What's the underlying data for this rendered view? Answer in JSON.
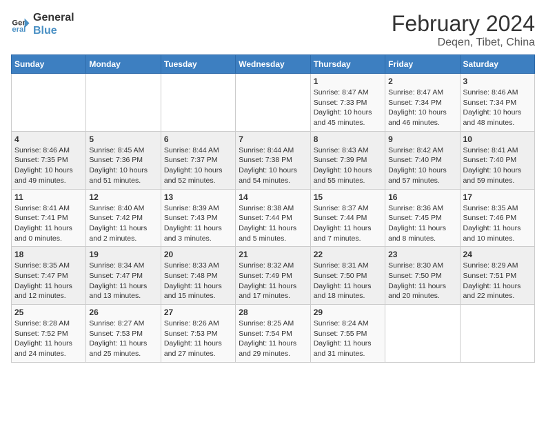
{
  "logo": {
    "text_general": "General",
    "text_blue": "Blue"
  },
  "title": "February 2024",
  "subtitle": "Deqen, Tibet, China",
  "weekdays": [
    "Sunday",
    "Monday",
    "Tuesday",
    "Wednesday",
    "Thursday",
    "Friday",
    "Saturday"
  ],
  "weeks": [
    [
      {
        "day": "",
        "info": ""
      },
      {
        "day": "",
        "info": ""
      },
      {
        "day": "",
        "info": ""
      },
      {
        "day": "",
        "info": ""
      },
      {
        "day": "1",
        "info": "Sunrise: 8:47 AM\nSunset: 7:33 PM\nDaylight: 10 hours\nand 45 minutes."
      },
      {
        "day": "2",
        "info": "Sunrise: 8:47 AM\nSunset: 7:34 PM\nDaylight: 10 hours\nand 46 minutes."
      },
      {
        "day": "3",
        "info": "Sunrise: 8:46 AM\nSunset: 7:34 PM\nDaylight: 10 hours\nand 48 minutes."
      }
    ],
    [
      {
        "day": "4",
        "info": "Sunrise: 8:46 AM\nSunset: 7:35 PM\nDaylight: 10 hours\nand 49 minutes."
      },
      {
        "day": "5",
        "info": "Sunrise: 8:45 AM\nSunset: 7:36 PM\nDaylight: 10 hours\nand 51 minutes."
      },
      {
        "day": "6",
        "info": "Sunrise: 8:44 AM\nSunset: 7:37 PM\nDaylight: 10 hours\nand 52 minutes."
      },
      {
        "day": "7",
        "info": "Sunrise: 8:44 AM\nSunset: 7:38 PM\nDaylight: 10 hours\nand 54 minutes."
      },
      {
        "day": "8",
        "info": "Sunrise: 8:43 AM\nSunset: 7:39 PM\nDaylight: 10 hours\nand 55 minutes."
      },
      {
        "day": "9",
        "info": "Sunrise: 8:42 AM\nSunset: 7:40 PM\nDaylight: 10 hours\nand 57 minutes."
      },
      {
        "day": "10",
        "info": "Sunrise: 8:41 AM\nSunset: 7:40 PM\nDaylight: 10 hours\nand 59 minutes."
      }
    ],
    [
      {
        "day": "11",
        "info": "Sunrise: 8:41 AM\nSunset: 7:41 PM\nDaylight: 11 hours\nand 0 minutes."
      },
      {
        "day": "12",
        "info": "Sunrise: 8:40 AM\nSunset: 7:42 PM\nDaylight: 11 hours\nand 2 minutes."
      },
      {
        "day": "13",
        "info": "Sunrise: 8:39 AM\nSunset: 7:43 PM\nDaylight: 11 hours\nand 3 minutes."
      },
      {
        "day": "14",
        "info": "Sunrise: 8:38 AM\nSunset: 7:44 PM\nDaylight: 11 hours\nand 5 minutes."
      },
      {
        "day": "15",
        "info": "Sunrise: 8:37 AM\nSunset: 7:44 PM\nDaylight: 11 hours\nand 7 minutes."
      },
      {
        "day": "16",
        "info": "Sunrise: 8:36 AM\nSunset: 7:45 PM\nDaylight: 11 hours\nand 8 minutes."
      },
      {
        "day": "17",
        "info": "Sunrise: 8:35 AM\nSunset: 7:46 PM\nDaylight: 11 hours\nand 10 minutes."
      }
    ],
    [
      {
        "day": "18",
        "info": "Sunrise: 8:35 AM\nSunset: 7:47 PM\nDaylight: 11 hours\nand 12 minutes."
      },
      {
        "day": "19",
        "info": "Sunrise: 8:34 AM\nSunset: 7:47 PM\nDaylight: 11 hours\nand 13 minutes."
      },
      {
        "day": "20",
        "info": "Sunrise: 8:33 AM\nSunset: 7:48 PM\nDaylight: 11 hours\nand 15 minutes."
      },
      {
        "day": "21",
        "info": "Sunrise: 8:32 AM\nSunset: 7:49 PM\nDaylight: 11 hours\nand 17 minutes."
      },
      {
        "day": "22",
        "info": "Sunrise: 8:31 AM\nSunset: 7:50 PM\nDaylight: 11 hours\nand 18 minutes."
      },
      {
        "day": "23",
        "info": "Sunrise: 8:30 AM\nSunset: 7:50 PM\nDaylight: 11 hours\nand 20 minutes."
      },
      {
        "day": "24",
        "info": "Sunrise: 8:29 AM\nSunset: 7:51 PM\nDaylight: 11 hours\nand 22 minutes."
      }
    ],
    [
      {
        "day": "25",
        "info": "Sunrise: 8:28 AM\nSunset: 7:52 PM\nDaylight: 11 hours\nand 24 minutes."
      },
      {
        "day": "26",
        "info": "Sunrise: 8:27 AM\nSunset: 7:53 PM\nDaylight: 11 hours\nand 25 minutes."
      },
      {
        "day": "27",
        "info": "Sunrise: 8:26 AM\nSunset: 7:53 PM\nDaylight: 11 hours\nand 27 minutes."
      },
      {
        "day": "28",
        "info": "Sunrise: 8:25 AM\nSunset: 7:54 PM\nDaylight: 11 hours\nand 29 minutes."
      },
      {
        "day": "29",
        "info": "Sunrise: 8:24 AM\nSunset: 7:55 PM\nDaylight: 11 hours\nand 31 minutes."
      },
      {
        "day": "",
        "info": ""
      },
      {
        "day": "",
        "info": ""
      }
    ]
  ]
}
